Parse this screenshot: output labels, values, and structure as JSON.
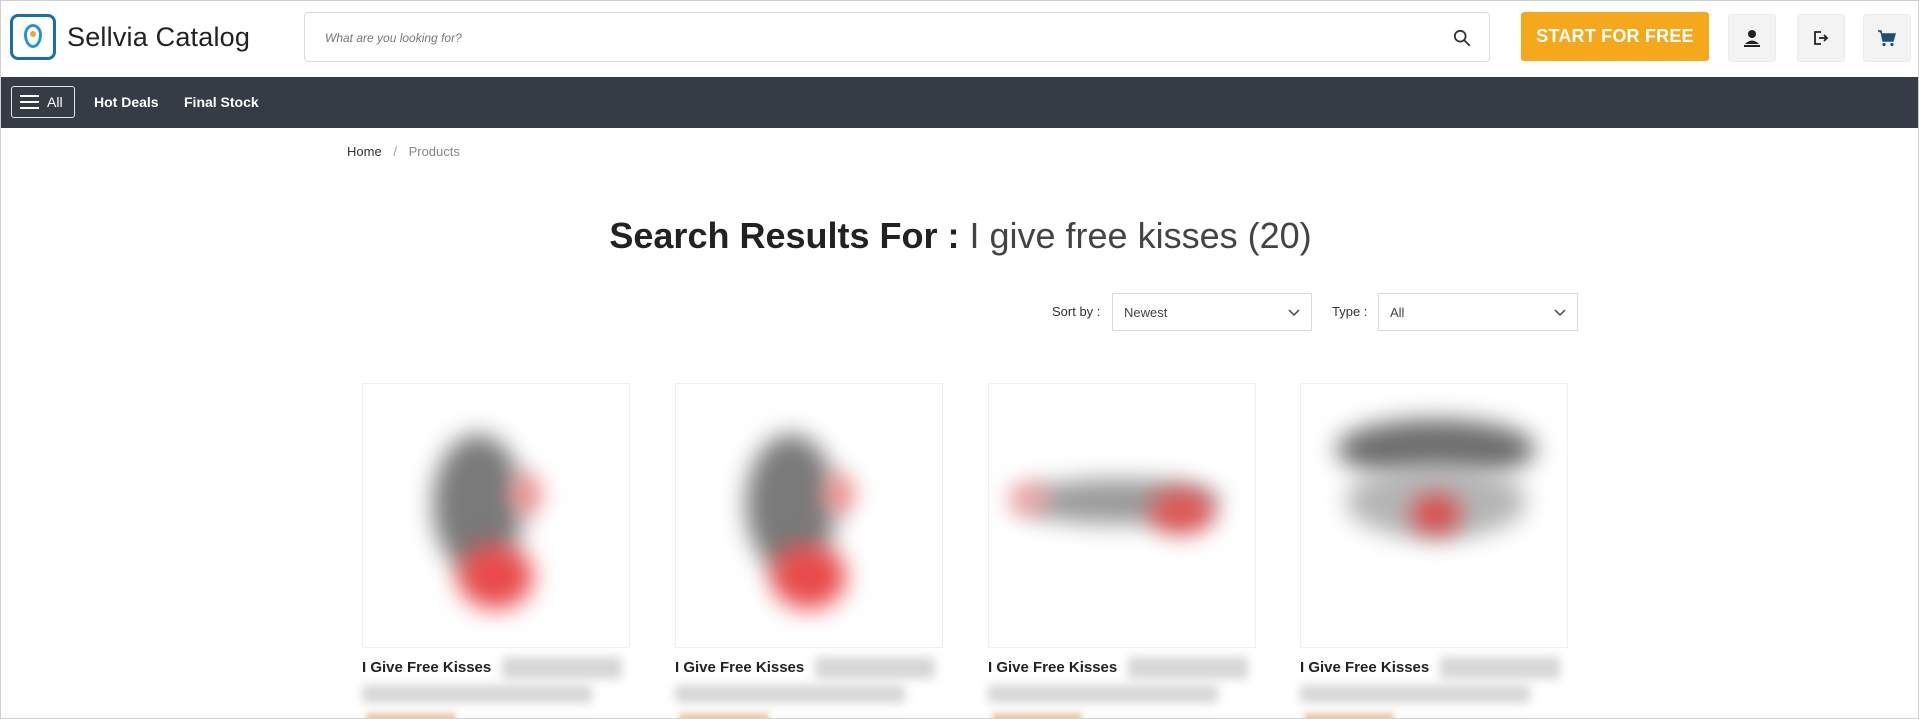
{
  "header": {
    "logo_text": "Sellvia Catalog",
    "search_placeholder": "What are you looking for?",
    "cta_label": "START FOR FREE",
    "icons": [
      "user-icon",
      "logout-icon",
      "cart-icon"
    ]
  },
  "nav": {
    "all_label": "All",
    "links": [
      "Hot Deals",
      "Final Stock"
    ]
  },
  "breadcrumb": {
    "home": "Home",
    "separator": "/",
    "current": "Products"
  },
  "results": {
    "label": "Search Results For :",
    "query": "I give free kisses (20)"
  },
  "filters": {
    "sort_label": "Sort by :",
    "sort_value": "Newest",
    "type_label": "Type :",
    "type_value": "All"
  },
  "products": [
    {
      "name": "I Give Free Kisses"
    },
    {
      "name": "I Give Free Kisses"
    },
    {
      "name": "I Give Free Kisses"
    },
    {
      "name": "I Give Free Kisses"
    }
  ],
  "colors": {
    "accent": "#f6a81c",
    "navbar": "#353c46",
    "logo_blue": "#1b6fa8"
  }
}
